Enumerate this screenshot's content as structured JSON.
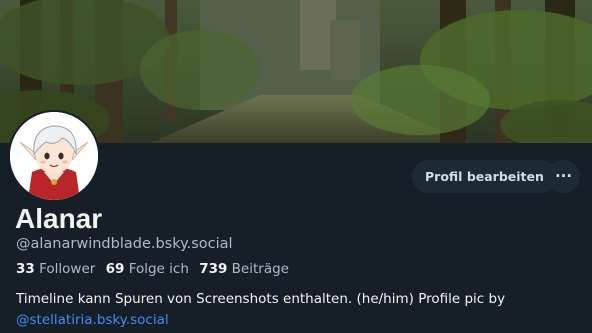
{
  "profile": {
    "display_name": "Alanar",
    "handle": "@alanarwindblade.bsky.social",
    "stats": {
      "followers_count": "33",
      "followers_label": "Follower",
      "following_count": "69",
      "following_label": "Folge ich",
      "posts_count": "739",
      "posts_label": "Beiträge"
    },
    "bio_text": "Timeline kann Spuren von Screenshots enthalten. (he/him) Profile pic by",
    "bio_link": "@stellatiria.bsky.social"
  },
  "actions": {
    "edit_profile_label": "Profil bearbeiten",
    "more_label": "···"
  },
  "colors": {
    "background": "#161e27",
    "button_bg": "#1e2936",
    "link": "#3f8ef5",
    "muted_text": "#aebbc9"
  },
  "icons": {
    "banner": "forest-banner-image",
    "avatar": "elf-avatar-image",
    "more": "ellipsis-icon"
  }
}
